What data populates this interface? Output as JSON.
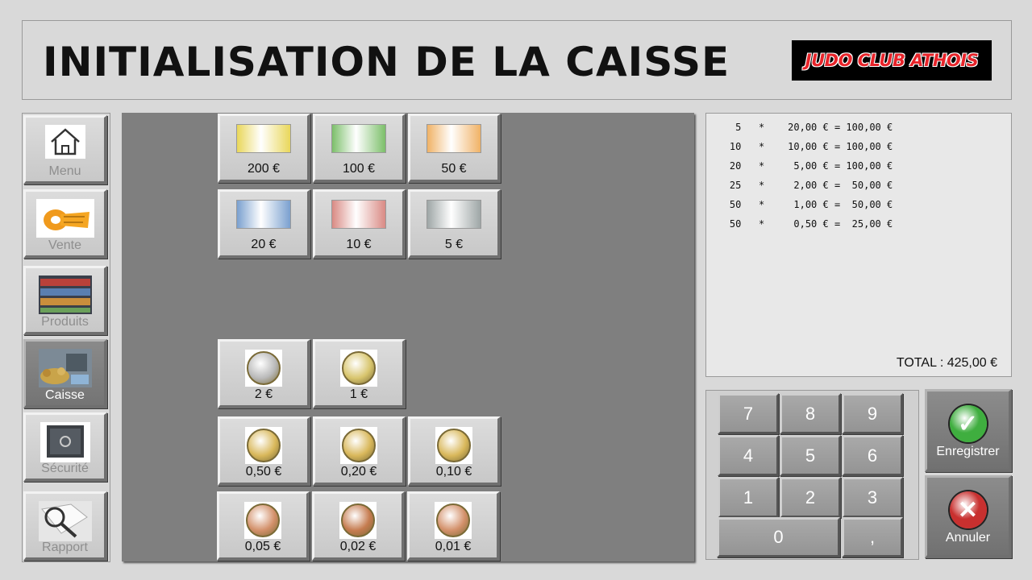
{
  "header": {
    "title": "INITIALISATION DE LA CAISSE",
    "logo_text": "JUDO CLUB ATHOIS"
  },
  "sidebar": {
    "items": [
      {
        "label": "Menu",
        "icon": "home-icon",
        "active": false
      },
      {
        "label": "Vente",
        "icon": "ticket-icon",
        "active": false
      },
      {
        "label": "Produits",
        "icon": "products-shelf-icon",
        "active": false
      },
      {
        "label": "Caisse",
        "icon": "cash-register-icon",
        "active": true
      },
      {
        "label": "Sécurité",
        "icon": "safe-icon",
        "active": false
      },
      {
        "label": "Rapport",
        "icon": "report-magnifier-icon",
        "active": false
      }
    ]
  },
  "denominations": {
    "bills": [
      {
        "label": "200 €",
        "color": "#e9d75a"
      },
      {
        "label": "100 €",
        "color": "#7cbf6a"
      },
      {
        "label": "50 €",
        "color": "#f0b266"
      },
      {
        "label": "20 €",
        "color": "#7aa0cf"
      },
      {
        "label": "10 €",
        "color": "#d98a84"
      },
      {
        "label": "5 €",
        "color": "#9ea6a6"
      }
    ],
    "coins": [
      {
        "label": "2 €",
        "color": "#b9b9b9"
      },
      {
        "label": "1 €",
        "color": "#d8c56d"
      },
      {
        "label": "0,50 €",
        "color": "#d9b85b"
      },
      {
        "label": "0,20 €",
        "color": "#d9b85b"
      },
      {
        "label": "0,10 €",
        "color": "#d9b85b"
      },
      {
        "label": "0,05 €",
        "color": "#d3906a"
      },
      {
        "label": "0,02 €",
        "color": "#c57b4f"
      },
      {
        "label": "0,01 €",
        "color": "#d3906a"
      }
    ]
  },
  "summary": {
    "lines": [
      {
        "qty": "5",
        "unit": "20,00 €",
        "amount": "100,00 €"
      },
      {
        "qty": "10",
        "unit": "10,00 €",
        "amount": "100,00 €"
      },
      {
        "qty": "20",
        "unit": "5,00 €",
        "amount": "100,00 €"
      },
      {
        "qty": "25",
        "unit": "2,00 €",
        "amount": "50,00 €"
      },
      {
        "qty": "50",
        "unit": "1,00 €",
        "amount": "50,00 €"
      },
      {
        "qty": "50",
        "unit": "0,50 €",
        "amount": "25,00 €"
      }
    ],
    "total": "TOTAL : 425,00 €"
  },
  "keypad": {
    "keys": [
      "7",
      "8",
      "9",
      "4",
      "5",
      "6",
      "1",
      "2",
      "3",
      "0",
      ","
    ]
  },
  "actions": {
    "save_label": "Enregistrer",
    "cancel_label": "Annuler",
    "save_color": "#3fae3f",
    "cancel_color": "#c8302f"
  }
}
